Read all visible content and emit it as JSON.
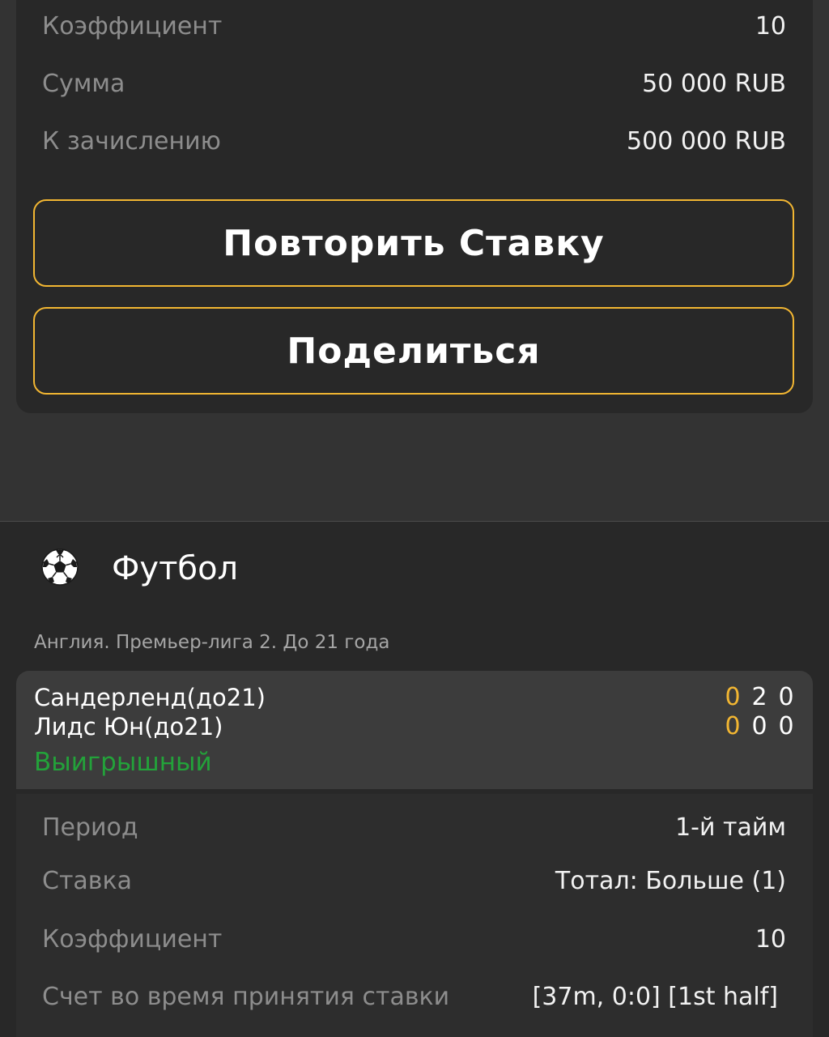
{
  "summary": {
    "rows": [
      {
        "label": "Коэффициент",
        "value": "10"
      },
      {
        "label": "Сумма",
        "value": "50 000 RUB"
      },
      {
        "label": "К зачислению",
        "value": "500 000 RUB"
      }
    ],
    "repeat_label": "Повторить Ставку",
    "share_label": "Поделиться"
  },
  "sport": {
    "icon": "soccer-ball-icon",
    "title": "Футбол",
    "league": "Англия. Премьер-лига 2. До 21 года"
  },
  "match": {
    "teams": [
      {
        "name": "Сандерленд(до21)",
        "scores": [
          "0",
          "2",
          "0"
        ]
      },
      {
        "name": "Лидс Юн(до21)",
        "scores": [
          "0",
          "0",
          "0"
        ]
      }
    ],
    "status": "Выигрышный"
  },
  "details": {
    "rows": [
      {
        "label": "Период",
        "value": "1-й тайм"
      },
      {
        "label": "Ставка",
        "value": "Тотал: Больше (1)"
      },
      {
        "label": "Коэффициент",
        "value": "10"
      },
      {
        "label": "Счет во время принятия ставки",
        "value": "[37m, 0:0] [1st half]"
      }
    ]
  },
  "colors": {
    "accent": "#f2b632",
    "win": "#23a23a",
    "background": "#333333",
    "card": "#282828"
  }
}
